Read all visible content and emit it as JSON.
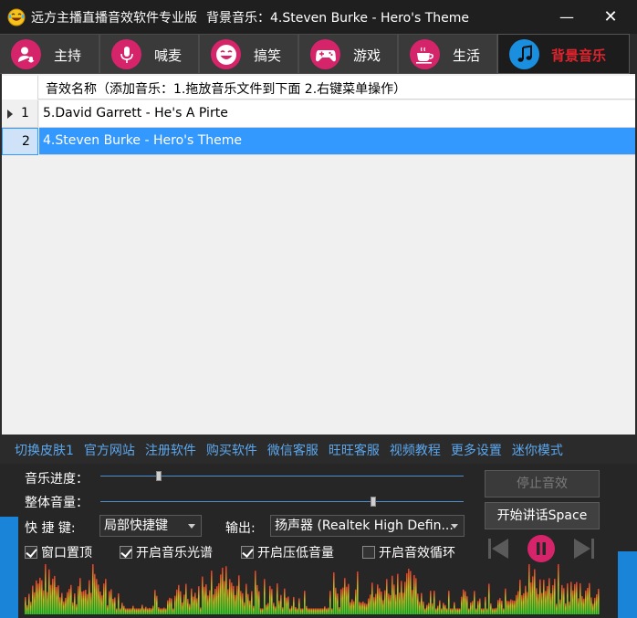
{
  "window": {
    "app_name": "远方主播直播音效软件专业版",
    "now_playing": "背景音乐：4.Steven Burke - Hero's Theme",
    "minimize_glyph": "—",
    "close_glyph": "✕"
  },
  "tabs": [
    {
      "label": "主持",
      "icon": "user-mic-icon"
    },
    {
      "label": "喊麦",
      "icon": "microphone-icon"
    },
    {
      "label": "搞笑",
      "icon": "laugh-face-icon"
    },
    {
      "label": "游戏",
      "icon": "gamepad-icon"
    },
    {
      "label": "生活",
      "icon": "coffee-cup-icon"
    },
    {
      "label": "背景音乐",
      "icon": "music-note-icon",
      "active": true
    }
  ],
  "list": {
    "header": "音效名称（添加音乐：1.拖放音乐文件到下面   2.右键菜单操作）",
    "rows": [
      {
        "num": "1",
        "name": "5.David Garrett - He's A Pirte",
        "selected": false
      },
      {
        "num": "2",
        "name": "4.Steven Burke - Hero's Theme",
        "selected": true
      }
    ]
  },
  "links": [
    "切换皮肤1",
    "官方网站",
    "注册软件",
    "购买软件",
    "微信客服",
    "旺旺客服",
    "视频教程",
    "更多设置",
    "迷你模式"
  ],
  "controls": {
    "progress_label": "音乐进度：",
    "progress_value": 0.16,
    "volume_label": "整体音量：",
    "volume_value": 0.75,
    "hotkey_label": "快 捷 键:",
    "hotkey_value": "局部快捷键",
    "output_label": "输出:",
    "output_value": "扬声器 (Realtek High Defin...",
    "stop_button": "停止音效",
    "talk_button": "开始讲话Space",
    "checkboxes": [
      {
        "label": "窗口置顶",
        "checked": true
      },
      {
        "label": "开启音乐光谱",
        "checked": true
      },
      {
        "label": "开启压低音量",
        "checked": true
      },
      {
        "label": "开启音效循环",
        "checked": false
      }
    ]
  },
  "colors": {
    "accent_pink": "#d6246b",
    "accent_blue": "#1a8fe0",
    "link_blue": "#5ba7ee",
    "active_tab_text": "#e0242e"
  }
}
